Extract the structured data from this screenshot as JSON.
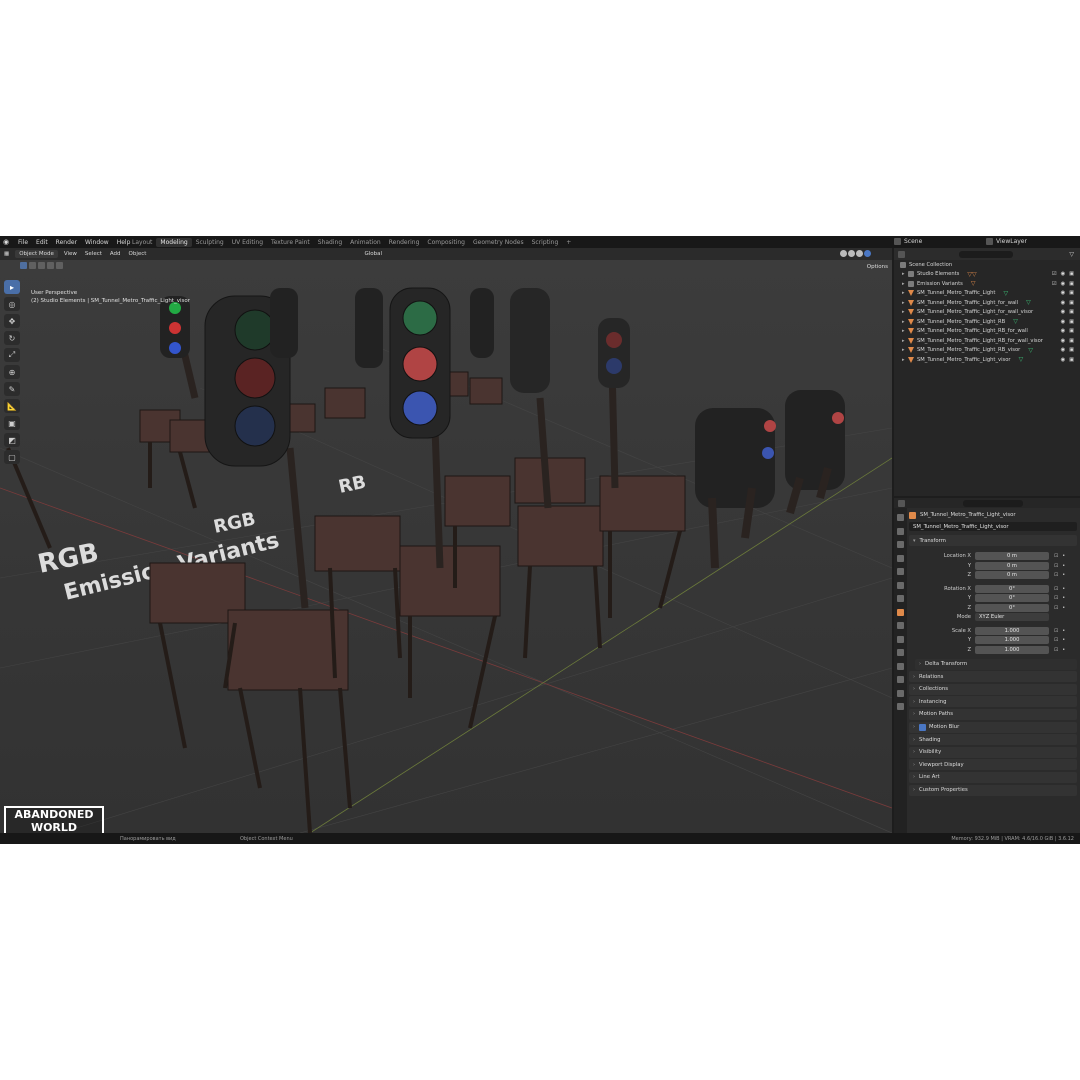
{
  "app": {
    "menus": [
      "File",
      "Edit",
      "Render",
      "Window",
      "Help"
    ],
    "workspaces": [
      "Layout",
      "Modeling",
      "Sculpting",
      "UV Editing",
      "Texture Paint",
      "Shading",
      "Animation",
      "Rendering",
      "Compositing",
      "Geometry Nodes",
      "Scripting",
      "+"
    ],
    "active_workspace": "Modeling",
    "scene": "Scene",
    "view_layer": "ViewLayer"
  },
  "viewport": {
    "mode": "Object Mode",
    "menus": [
      "View",
      "Select",
      "Add",
      "Object"
    ],
    "orientation": "Global",
    "options": "Options",
    "info_line1": "User Perspective",
    "info_line2": "(2) Studio Elements | SM_Tunnel_Metro_Traffic_Light_visor",
    "floor_text_1": "RGB",
    "floor_text_2": "Emission Variants",
    "floor_text_3": "RGB",
    "floor_text_4": "RB",
    "logo_line1": "ABANDONED",
    "logo_line2": "WORLD"
  },
  "outliner": {
    "root": "Scene Collection",
    "rows": [
      {
        "name": "Studio Elements",
        "type": "collection"
      },
      {
        "name": "Emission Variants",
        "type": "collection"
      },
      {
        "name": "SM_Tunnel_Metro_Traffic_Light",
        "type": "mesh"
      },
      {
        "name": "SM_Tunnel_Metro_Traffic_Light_for_wall",
        "type": "mesh"
      },
      {
        "name": "SM_Tunnel_Metro_Traffic_Light_for_wall_visor",
        "type": "mesh"
      },
      {
        "name": "SM_Tunnel_Metro_Traffic_Light_RB",
        "type": "mesh"
      },
      {
        "name": "SM_Tunnel_Metro_Traffic_Light_RB_for_wall",
        "type": "mesh"
      },
      {
        "name": "SM_Tunnel_Metro_Traffic_Light_RB_for_wall_visor",
        "type": "mesh"
      },
      {
        "name": "SM_Tunnel_Metro_Traffic_Light_RB_visor",
        "type": "mesh"
      },
      {
        "name": "SM_Tunnel_Metro_Traffic_Light_visor",
        "type": "mesh"
      }
    ]
  },
  "properties": {
    "object_name": "SM_Tunnel_Metro_Traffic_Light_visor",
    "object_field": "SM_Tunnel_Metro_Traffic_Light_visor",
    "transform_title": "Transform",
    "location_x_label": "Location X",
    "location_x": "0 m",
    "location_y": "0 m",
    "location_z": "0 m",
    "rotation_x_label": "Rotation X",
    "rotation_x": "0°",
    "rotation_y": "0°",
    "rotation_z": "0°",
    "mode_label": "Mode",
    "mode": "XYZ Euler",
    "scale_x_label": "Scale X",
    "scale_x": "1.000",
    "scale_y": "1.000",
    "scale_z": "1.000",
    "y_label": "Y",
    "z_label": "Z",
    "delta_transform": "Delta Transform",
    "panels": [
      "Relations",
      "Collections",
      "Instancing",
      "Motion Paths",
      "Motion Blur",
      "Shading",
      "Visibility",
      "Viewport Display",
      "Line Art",
      "Custom Properties"
    ]
  },
  "statusbar": {
    "hint1": "Панорамировать вид",
    "hint2": "Object Context Menu",
    "stats": "Memory: 932.9 MiB | VRAM: 4.6/16.0 GiB | 3.6.12"
  },
  "colors": {
    "accent": "#4a77c4",
    "object_orange": "#e08a4a",
    "vertex_green": "#3cc57a"
  }
}
